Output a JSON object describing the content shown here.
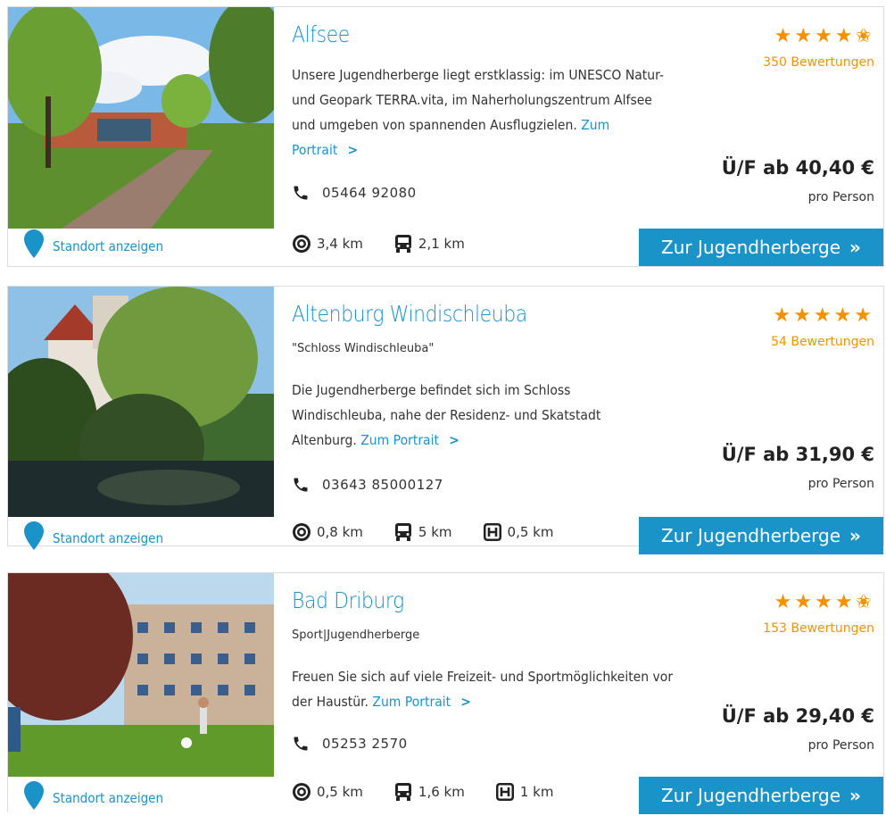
{
  "cards": [
    {
      "name": "Alfsee",
      "subtitle": "",
      "description": "Unsere Jugendherberge liegt erstklassig: im UNESCO Natur- und Geopark TERRA.vita, im Naherholungszentrum Alfsee und umgeben von spannenden Ausflugzielen.",
      "portrait_link": "Zum Portrait",
      "phone": "05464 92080",
      "rating": 4.5,
      "stars": "★★★★✬",
      "reviews": "350 Bewertungen",
      "price": "Ü/F ab 40,40 €",
      "per_person": "pro Person",
      "location_label": "Standort anzeigen",
      "cta": "Zur Jugendherberge",
      "distances": [
        {
          "icon": "target-icon",
          "value": "3,4 km"
        },
        {
          "icon": "bus-icon",
          "value": "2,1 km"
        }
      ]
    },
    {
      "name": "Altenburg Windischleuba",
      "subtitle": "\"Schloss Windischleuba\"",
      "description": "Die Jugendherberge befindet sich im Schloss Windischleuba, nahe der Residenz- und Skatstadt Altenburg.",
      "portrait_link": "Zum Portrait",
      "phone": "03643 85000127",
      "rating": 5,
      "stars": "★★★★★",
      "reviews": "54 Bewertungen",
      "price": "Ü/F ab 31,90 €",
      "per_person": "pro Person",
      "location_label": "Standort anzeigen",
      "cta": "Zur Jugendherberge",
      "distances": [
        {
          "icon": "target-icon",
          "value": "0,8 km"
        },
        {
          "icon": "bus-icon",
          "value": "5 km"
        },
        {
          "icon": "bus-stop-icon",
          "value": "0,5 km"
        }
      ]
    },
    {
      "name": "Bad Driburg",
      "subtitle": "Sport|Jugendherberge",
      "description": "Freuen Sie sich auf viele Freizeit- und Sportmöglichkeiten vor der Haustür.",
      "portrait_link": "Zum Portrait",
      "phone": "05253 2570",
      "rating": 4.5,
      "stars": "★★★★✬",
      "reviews": "153 Bewertungen",
      "price": "Ü/F ab 29,40 €",
      "per_person": "pro Person",
      "location_label": "Standort anzeigen",
      "cta": "Zur Jugendherberge",
      "distances": [
        {
          "icon": "target-icon",
          "value": "0,5 km"
        },
        {
          "icon": "bus-icon",
          "value": "1,6 km"
        },
        {
          "icon": "bus-stop-icon",
          "value": "1 km"
        }
      ]
    }
  ],
  "colors": {
    "accent": "#1a93c9",
    "stars": "#f39200"
  }
}
